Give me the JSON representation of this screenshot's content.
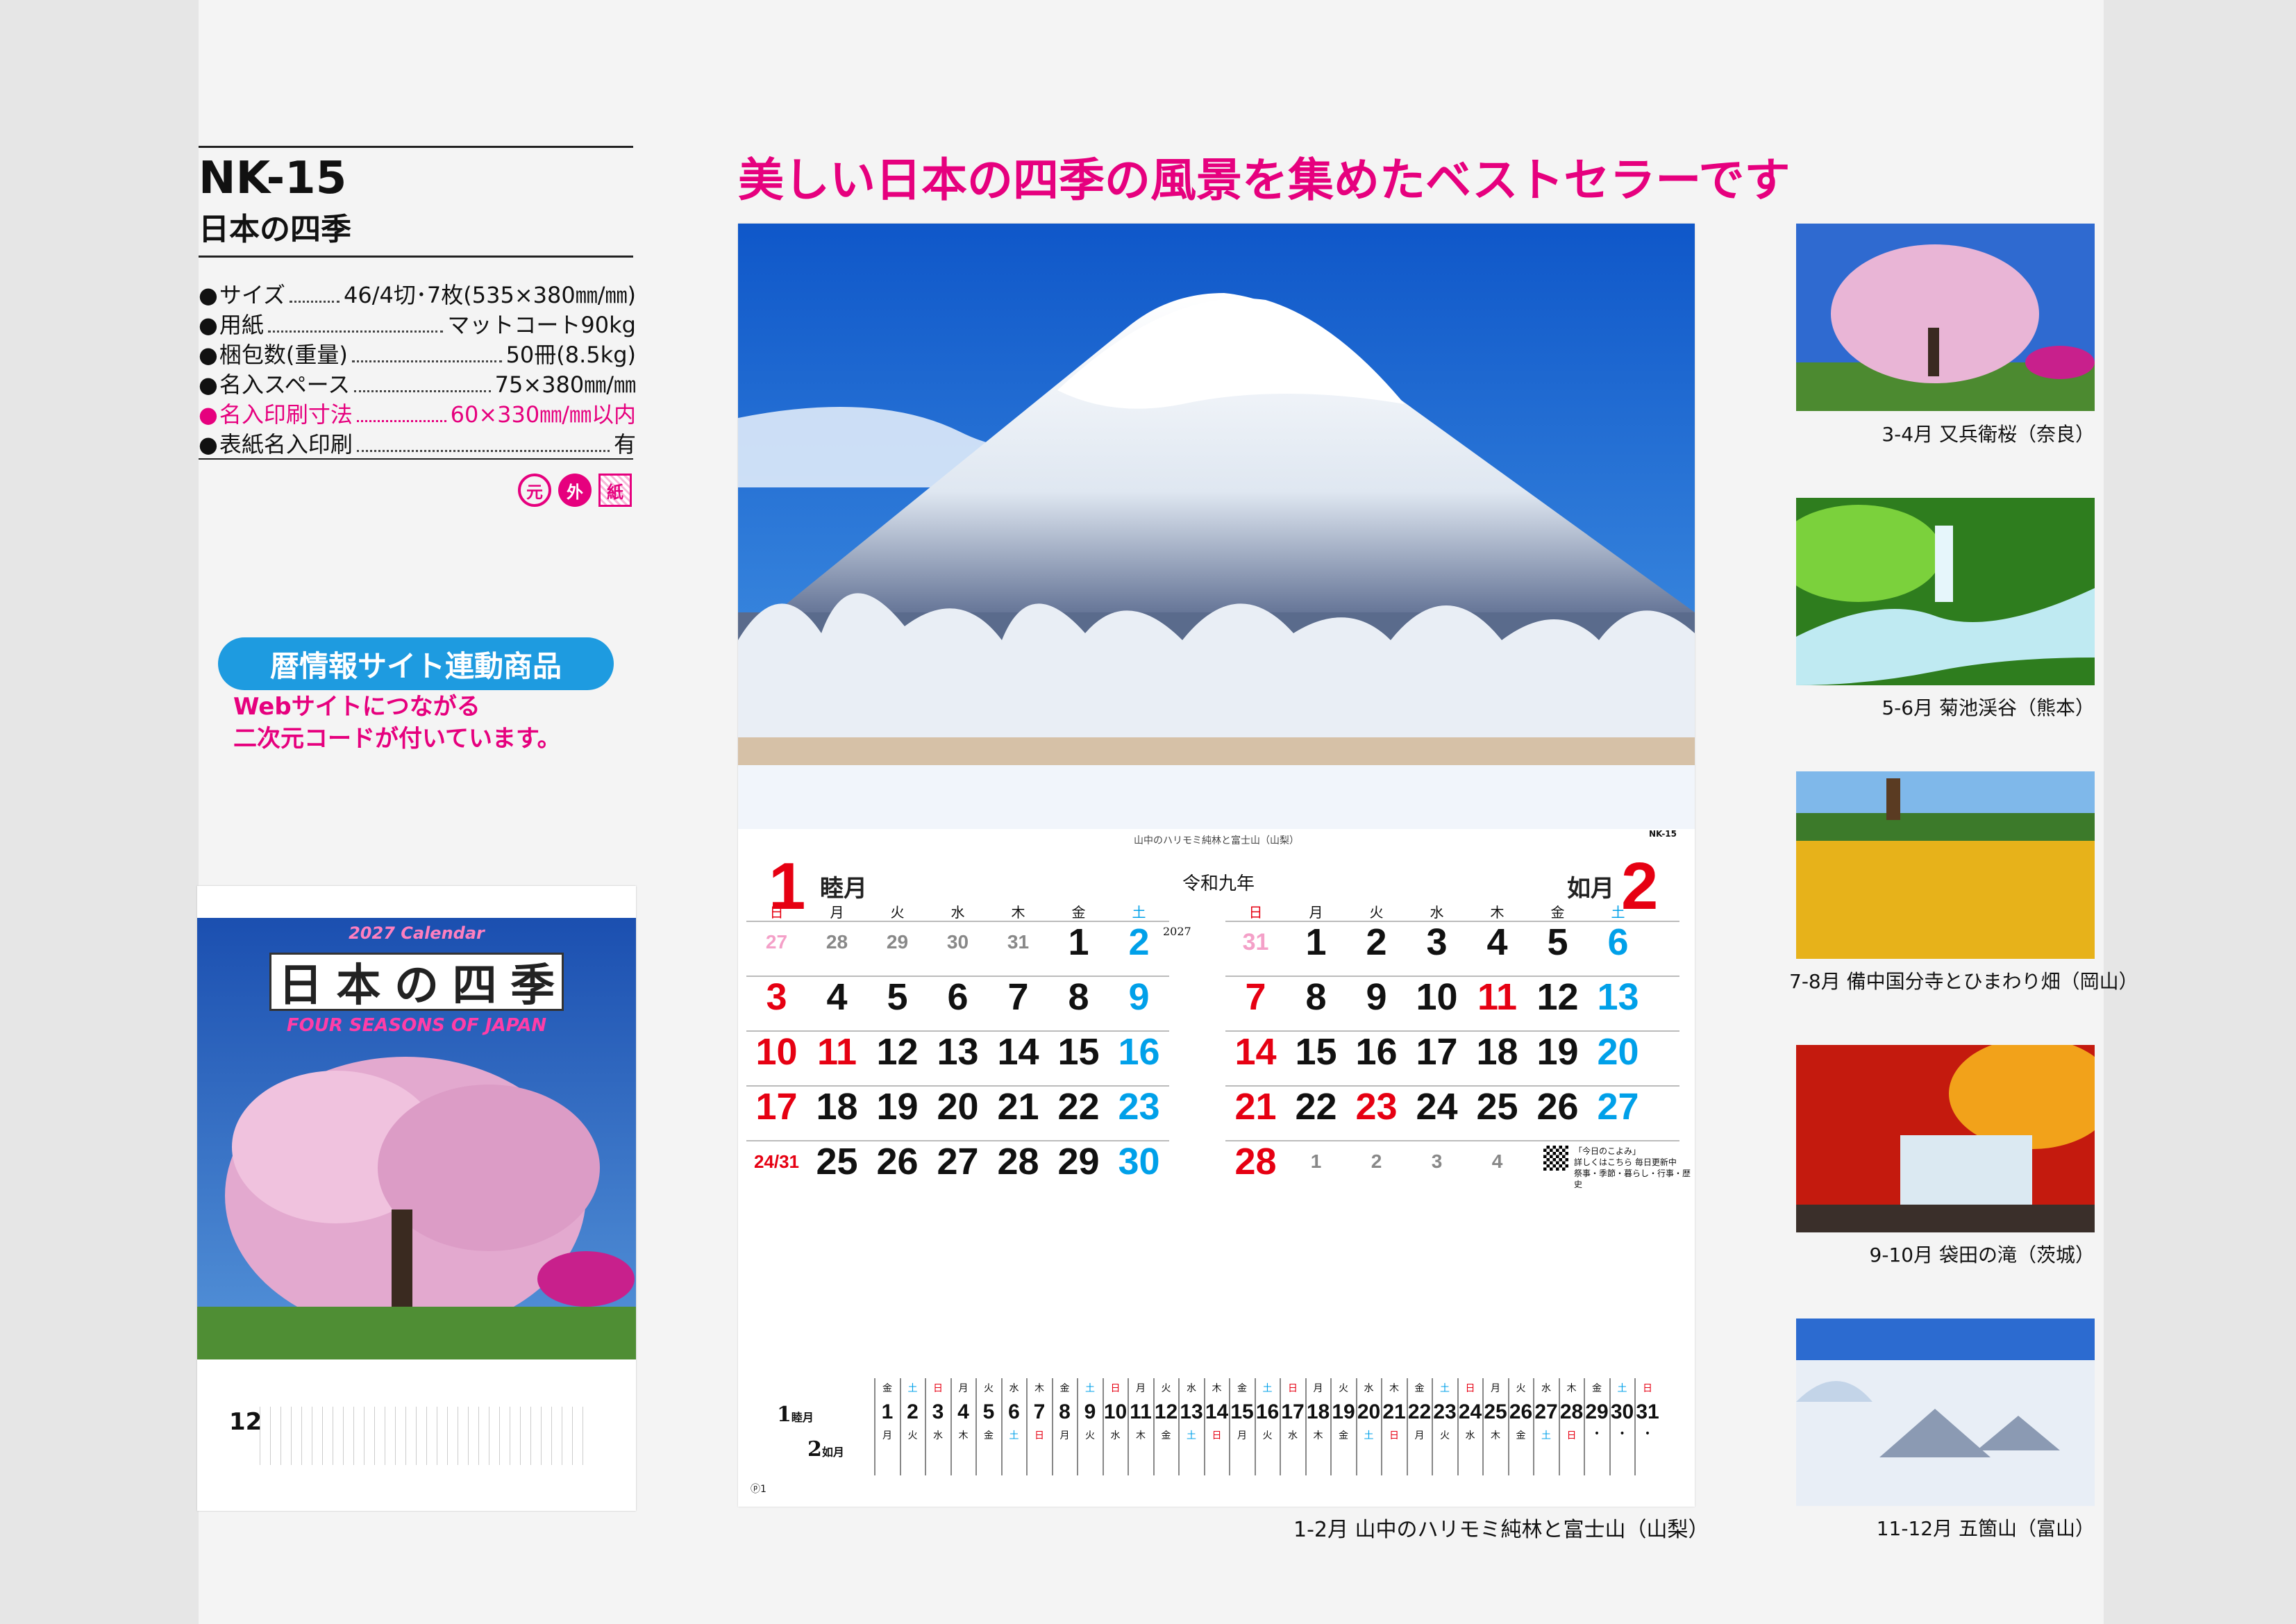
{
  "product": {
    "code": "NK-15",
    "name": "日本の四季"
  },
  "specs": [
    {
      "label": "サイズ",
      "value": "46/4切･7枚(535×380㎜/㎜)"
    },
    {
      "label": "用紙",
      "value": "マットコート90kg"
    },
    {
      "label": "梱包数(重量)",
      "value": "50冊(8.5kg)"
    },
    {
      "label": "名入スペース",
      "value": "75×380㎜/㎜"
    },
    {
      "label": "名入印刷寸法",
      "value": "60×330㎜/㎜以内",
      "highlight": true
    },
    {
      "label": "表紙名入印刷",
      "value": "有"
    }
  ],
  "marks": [
    "元",
    "外",
    "紙"
  ],
  "badge": "暦情報サイト連動商品",
  "badge_text": [
    "Webサイトにつながる",
    "二次元コードが付いています。"
  ],
  "headline": "美しい日本の四季の風景を集めたベストセラーです",
  "cover": {
    "year_title": "2027 Calendar",
    "title_chars": [
      "日",
      "本",
      "の",
      "四",
      "季"
    ],
    "subtitle": "FOUR SEASONS OF JAPAN",
    "month": "12"
  },
  "calendar": {
    "photo_caption": "山中のハリモミ純林と富士山（山梨）",
    "nk_mark": "NK-15",
    "era": "令和九年",
    "year": "2027",
    "page": "ⓟ1",
    "qr_text": [
      "「今日のこよみ」",
      "詳しくはこちら 毎日更新中",
      "祭事・季節・暮らし・行事・歴史"
    ],
    "weekdays": [
      "日",
      "月",
      "火",
      "水",
      "木",
      "金",
      "土"
    ],
    "jan": {
      "num": "1",
      "name": "睦月",
      "days": [
        [
          "27",
          "28",
          "29",
          "30",
          "31",
          "1",
          "2"
        ],
        [
          "3",
          "4",
          "5",
          "6",
          "7",
          "8",
          "9"
        ],
        [
          "10",
          "11",
          "12",
          "13",
          "14",
          "15",
          "16"
        ],
        [
          "17",
          "18",
          "19",
          "20",
          "21",
          "22",
          "23"
        ],
        [
          "24/31",
          "25",
          "26",
          "27",
          "28",
          "29",
          "30"
        ]
      ]
    },
    "feb": {
      "num": "2",
      "name": "如月",
      "days": [
        [
          "31",
          "1",
          "2",
          "3",
          "4",
          "5",
          "6"
        ],
        [
          "7",
          "8",
          "9",
          "10",
          "11",
          "12",
          "13"
        ],
        [
          "14",
          "15",
          "16",
          "17",
          "18",
          "19",
          "20"
        ],
        [
          "21",
          "22",
          "23",
          "24",
          "25",
          "26",
          "27"
        ],
        [
          "28",
          "1",
          "2",
          "3",
          "4",
          "",
          ""
        ]
      ]
    },
    "strip": {
      "label1": "1",
      "name1": "睦月",
      "label2": "2",
      "name2": "如月",
      "days": [
        "1",
        "2",
        "3",
        "4",
        "5",
        "6",
        "7",
        "8",
        "9",
        "10",
        "11",
        "12",
        "13",
        "14",
        "15",
        "16",
        "17",
        "18",
        "19",
        "20",
        "21",
        "22",
        "23",
        "24",
        "25",
        "26",
        "27",
        "28",
        "29",
        "30",
        "31"
      ],
      "wd1": [
        "金",
        "土",
        "日",
        "月",
        "火",
        "水",
        "木",
        "金",
        "土",
        "日",
        "月",
        "火",
        "水",
        "木",
        "金",
        "土",
        "日",
        "月",
        "火",
        "水",
        "木",
        "金",
        "土",
        "日",
        "月",
        "火",
        "水",
        "木",
        "金",
        "土",
        "日"
      ],
      "wd2": [
        "月",
        "火",
        "水",
        "木",
        "金",
        "土",
        "日",
        "月",
        "火",
        "水",
        "木",
        "金",
        "土",
        "日",
        "月",
        "火",
        "水",
        "木",
        "金",
        "土",
        "日",
        "月",
        "火",
        "水",
        "木",
        "金",
        "土",
        "日",
        "•",
        "•",
        "•"
      ]
    }
  },
  "main_caption": "1-2月 山中のハリモミ純林と富士山（山梨）",
  "thumbnails": [
    {
      "caption": "3-4月 又兵衛桜（奈良）"
    },
    {
      "caption": "5-6月 菊池渓谷（熊本）"
    },
    {
      "caption": "7-8月 備中国分寺とひまわり畑（岡山）"
    },
    {
      "caption": "9-10月 袋田の滝（茨城）"
    },
    {
      "caption": "11-12月 五箇山（富山）"
    }
  ],
  "colors": {
    "accent": "#e6007e",
    "badge": "#1e9be0",
    "sunday": "#e60012",
    "saturday": "#00a0e9"
  }
}
